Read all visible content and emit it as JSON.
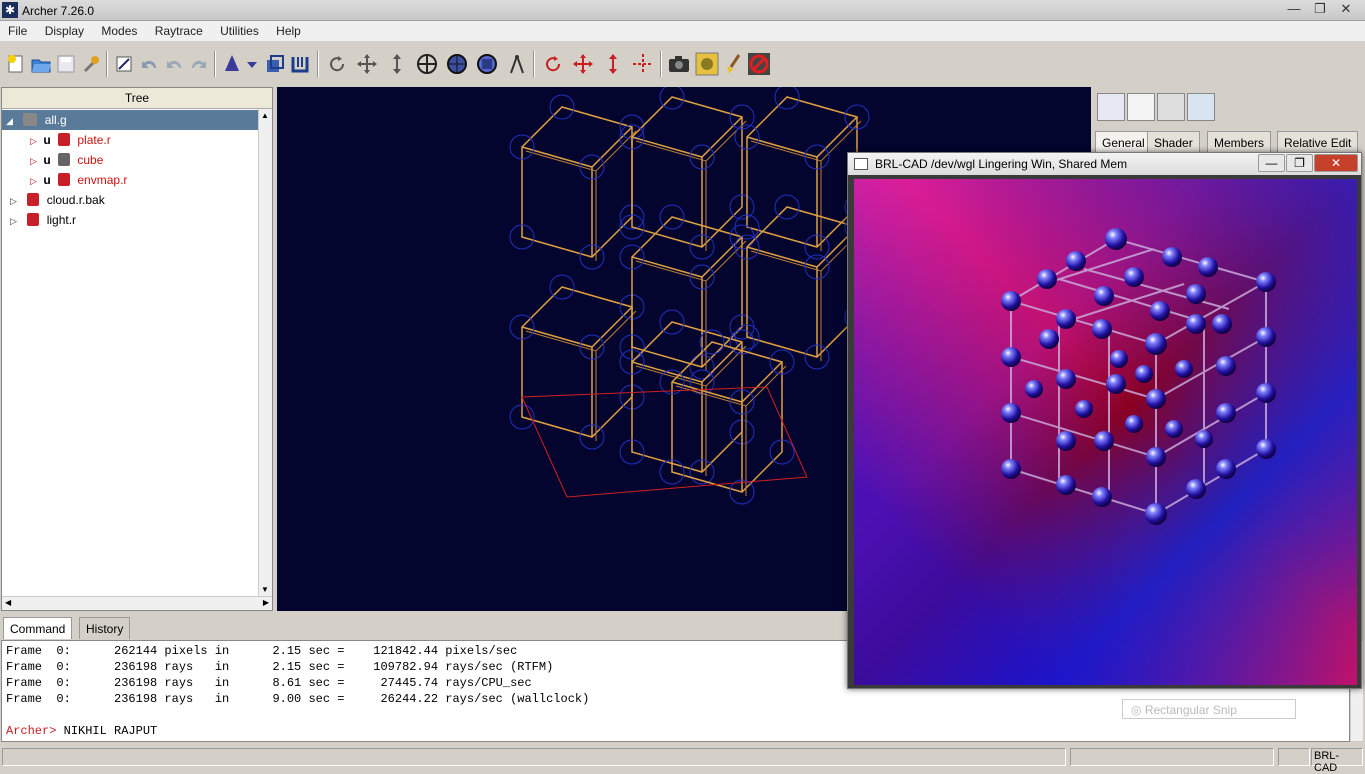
{
  "window": {
    "title": "Archer 7.26.0",
    "minimize": "—",
    "maximize": "❐",
    "close": "✕"
  },
  "menu": [
    "File",
    "Display",
    "Modes",
    "Raytrace",
    "Utilities",
    "Help"
  ],
  "toolbar": {
    "icons": [
      "new-file-icon",
      "open-folder-icon",
      "save-icon",
      "wrench-icon",
      "edit-icon",
      "undo-icon",
      "undo-multi-icon",
      "redo-icon",
      "wizard-icon",
      "dropdown-arrow-icon",
      "stack-icon",
      "pipe-icon",
      "rotate-icon",
      "translate-icon",
      "scale-icon",
      "center-icon",
      "sphere-view-icon",
      "cube-view-icon",
      "compass-icon",
      "rotate-object-icon",
      "translate-object-icon",
      "scale-object-icon",
      "center-object-icon",
      "camera-icon",
      "raytrace-icon",
      "clean-icon",
      "stop-raytrace-icon"
    ]
  },
  "tree": {
    "header": "Tree",
    "items": [
      {
        "label": "all.g",
        "prefix": "",
        "color": "normal"
      },
      {
        "label": "plate.r",
        "prefix": "u",
        "color": "red"
      },
      {
        "label": "cube",
        "prefix": "u",
        "color": "red"
      },
      {
        "label": "envmap.r",
        "prefix": "u",
        "color": "red"
      },
      {
        "label": "cloud.r.bak",
        "prefix": "",
        "color": "normal"
      },
      {
        "label": "light.r",
        "prefix": "",
        "color": "normal"
      }
    ]
  },
  "right_panel": {
    "tabs": [
      "General",
      "Shader",
      "Members",
      "Relative Edit"
    ],
    "icons": [
      "object-edit-icon",
      "table-icon",
      "gear-tool-icon",
      "layers-icon"
    ],
    "snip_label": "Rectangular Snip"
  },
  "bottom_tabs": [
    "Command",
    "History"
  ],
  "console": {
    "lines": [
      "Frame  0:      262144 pixels in      2.15 sec =    121842.44 pixels/sec",
      "Frame  0:      236198 rays   in      2.15 sec =    109782.94 rays/sec (RTFM)",
      "Frame  0:      236198 rays   in      8.61 sec =     27445.74 rays/CPU_sec",
      "Frame  0:      236198 rays   in      9.00 sec =     26244.22 rays/sec (wallclock)"
    ],
    "prompt": "Archer>",
    "input": " NIKHIL RAJPUT"
  },
  "status": {
    "right_label": "BRL-CAD"
  },
  "framebuffer": {
    "title": "BRL-CAD /dev/wgl Lingering Win, Shared Mem",
    "minimize": "—",
    "maximize": "❐",
    "close": "✕"
  }
}
